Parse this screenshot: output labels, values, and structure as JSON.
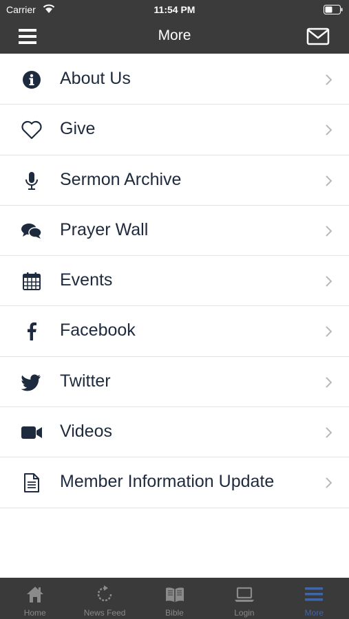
{
  "status": {
    "carrier": "Carrier",
    "time": "11:54 PM"
  },
  "header": {
    "title": "More"
  },
  "menu": [
    {
      "label": "About Us",
      "icon": "info-icon"
    },
    {
      "label": "Give",
      "icon": "heart-icon"
    },
    {
      "label": "Sermon Archive",
      "icon": "microphone-icon"
    },
    {
      "label": "Prayer Wall",
      "icon": "chat-bubbles-icon"
    },
    {
      "label": "Events",
      "icon": "calendar-icon"
    },
    {
      "label": "Facebook",
      "icon": "facebook-icon"
    },
    {
      "label": "Twitter",
      "icon": "twitter-icon"
    },
    {
      "label": "Videos",
      "icon": "video-camera-icon"
    },
    {
      "label": "Member Information Update",
      "icon": "document-icon"
    }
  ],
  "tabs": [
    {
      "label": "Home",
      "icon": "home-icon"
    },
    {
      "label": "News Feed",
      "icon": "refresh-icon"
    },
    {
      "label": "Bible",
      "icon": "book-icon"
    },
    {
      "label": "Login",
      "icon": "laptop-icon"
    },
    {
      "label": "More",
      "icon": "menu-icon",
      "active": true
    }
  ],
  "colors": {
    "header_bg": "#3b3b3b",
    "icon": "#1e2a3d",
    "tab_active": "#3f66a8",
    "tab_inactive": "#8a8a8a"
  }
}
